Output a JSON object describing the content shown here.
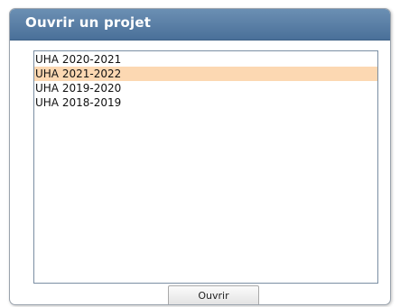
{
  "dialog": {
    "title": "Ouvrir un projet",
    "projects": [
      {
        "label": "UHA 2020-2021",
        "selected": false
      },
      {
        "label": "UHA 2021-2022",
        "selected": true
      },
      {
        "label": "UHA 2019-2020",
        "selected": false
      },
      {
        "label": "UHA 2018-2019",
        "selected": false
      }
    ],
    "open_button_label": "Ouvrir"
  },
  "colors": {
    "titlebar": "#5a7fa6",
    "selection": "#fcd8b2"
  }
}
